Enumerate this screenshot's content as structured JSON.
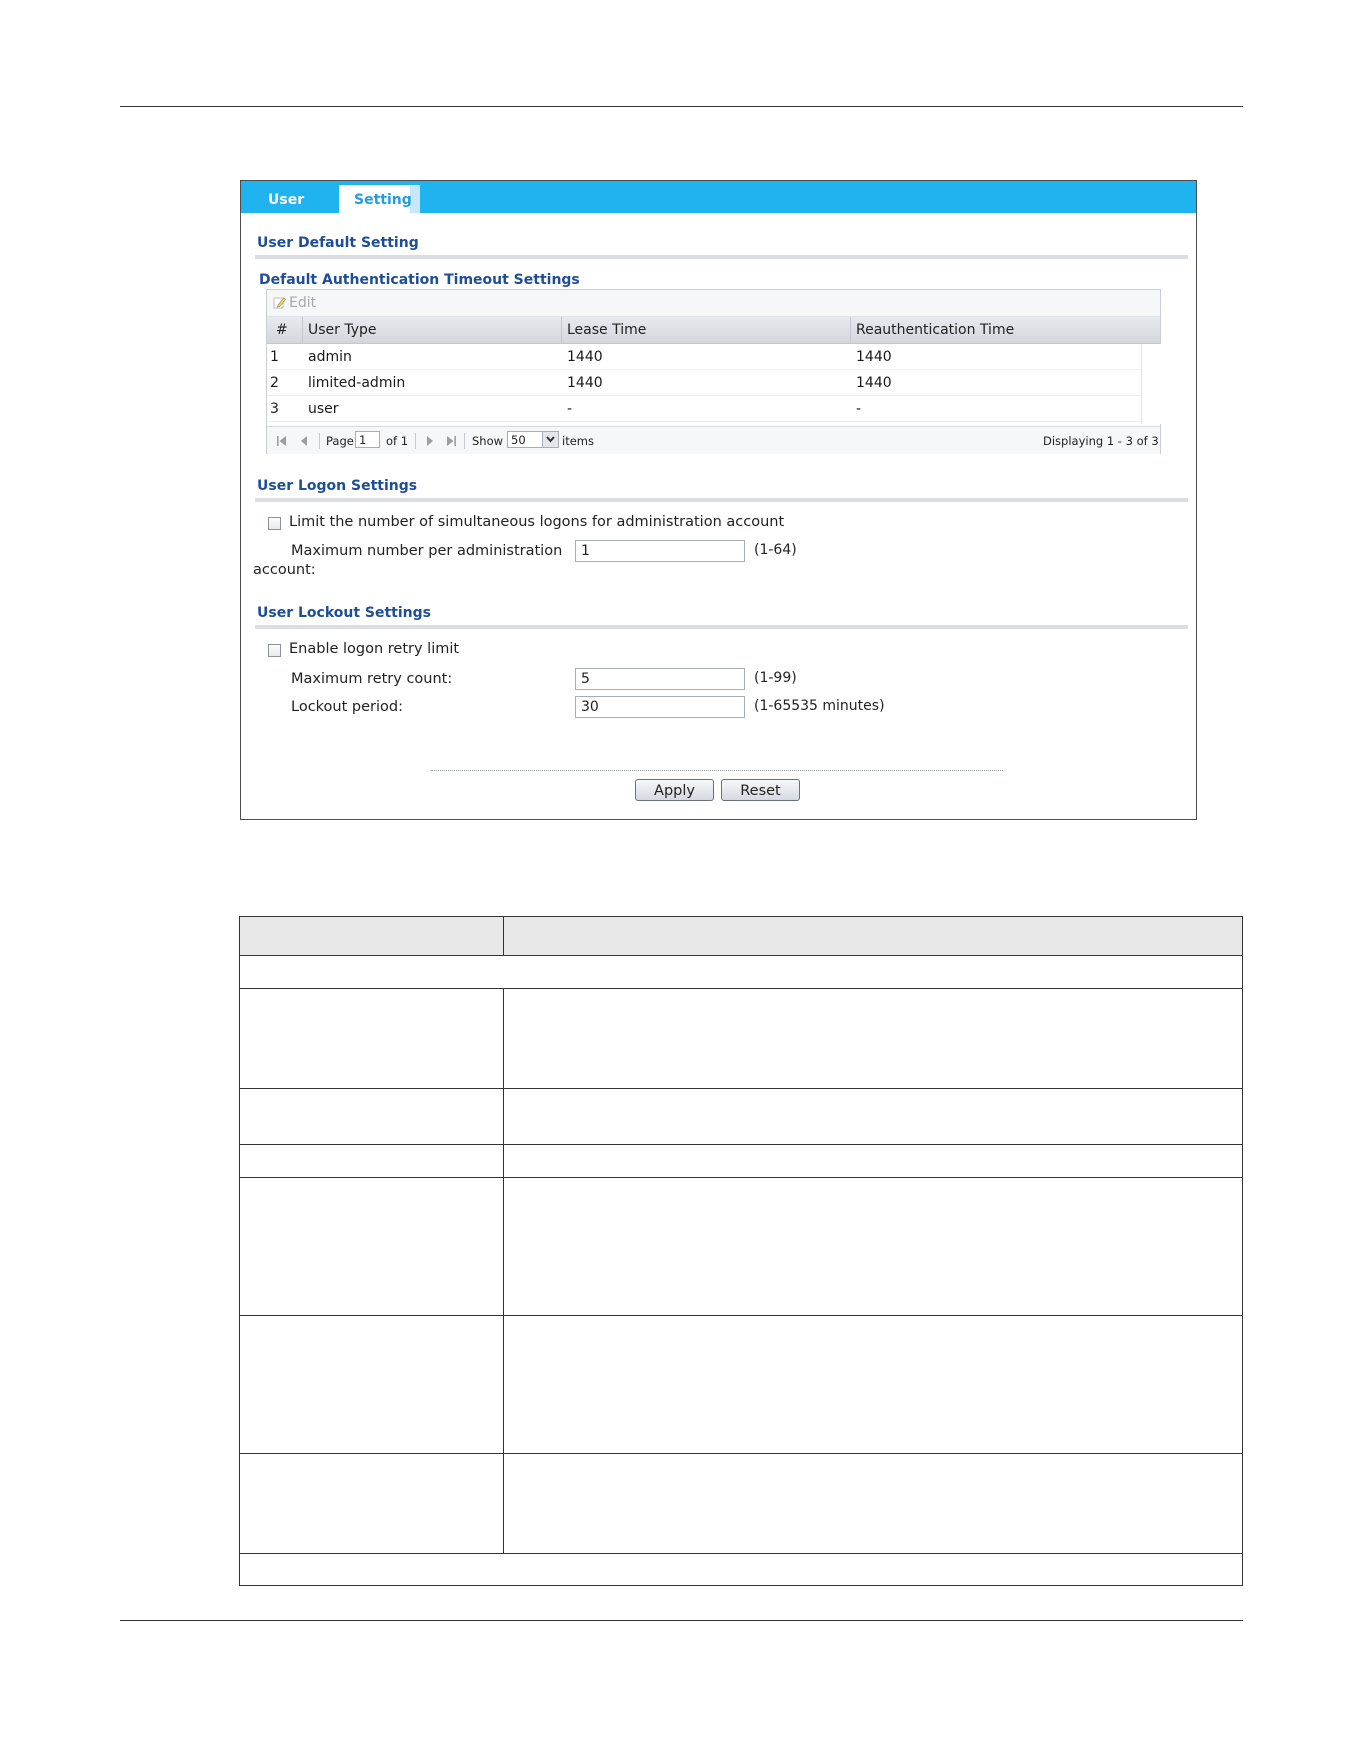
{
  "tabs": [
    {
      "label": "User",
      "active": false
    },
    {
      "label": "Setting",
      "active": true
    }
  ],
  "user_default": {
    "section_title": "User Default Setting",
    "subsection_title": "Default Authentication Timeout Settings",
    "edit_label": "Edit",
    "columns": [
      "#",
      "User Type",
      "Lease Time",
      "Reauthentication Time"
    ],
    "rows": [
      {
        "num": "1",
        "user_type": "admin",
        "lease": "1440",
        "reauth": "1440"
      },
      {
        "num": "2",
        "user_type": "limited-admin",
        "lease": "1440",
        "reauth": "1440"
      },
      {
        "num": "3",
        "user_type": "user",
        "lease": "-",
        "reauth": "-"
      }
    ],
    "pager": {
      "page_label": "Page",
      "page_value": "1",
      "of_label": "of 1",
      "show_label": "Show",
      "show_value": "50",
      "items_label": "items",
      "displaying": "Displaying 1 - 3 of 3"
    }
  },
  "logon": {
    "section_title": "User Logon Settings",
    "limit_label": "Limit the number of simultaneous logons for administration account",
    "limit_checked": false,
    "max_label_line1": "Maximum number per administration",
    "max_label_line2": "account:",
    "max_value": "1",
    "max_range": "(1-64)"
  },
  "lockout": {
    "section_title": "User Lockout Settings",
    "enable_label": "Enable logon retry limit",
    "enable_checked": false,
    "retry_label": "Maximum retry count:",
    "retry_value": "5",
    "retry_range": "(1-99)",
    "period_label": "Lockout period:",
    "period_value": "30",
    "period_range": "(1-65535 minutes)"
  },
  "buttons": {
    "apply": "Apply",
    "reset": "Reset"
  },
  "colors": {
    "tab_bar": "#1fb4ef",
    "section_title": "#1f4e96",
    "active_tab_text": "#1f9fe0"
  }
}
